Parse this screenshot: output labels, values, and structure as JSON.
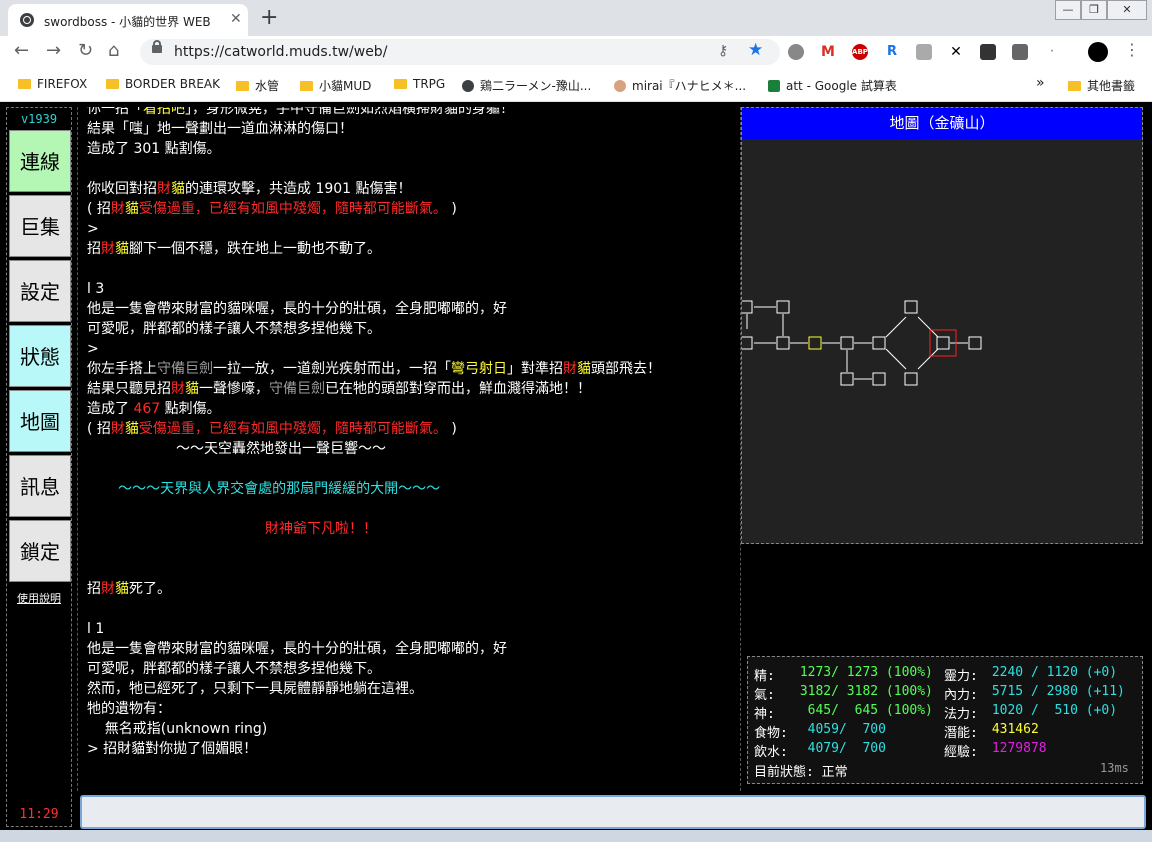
{
  "browser": {
    "tab_title": "swordboss - 小貓的世界 WEB",
    "tab_close": "✕",
    "new_tab": "+",
    "url": "https://catworld.muds.tw/web/",
    "win_min": "—",
    "win_max": "❐",
    "win_close": "✕",
    "bookmarks": [
      "FIREFOX",
      "BORDER BREAK",
      "水管",
      "小貓MUD",
      "TRPG",
      "鶏二ラーメン-豫山...",
      "mirai『ハナヒメ＊...",
      "att - Google 試算表"
    ],
    "bookmarks_overflow": "»",
    "other_bookmarks": "其他書籤"
  },
  "sidebar": {
    "version": "v1939",
    "buttons": [
      "連線",
      "巨集",
      "設定",
      "狀態",
      "地圖",
      "訊息",
      "鎖定"
    ],
    "help_link": "使用說明",
    "clock": "11:29"
  },
  "output_lines": [
    [
      [
        "w",
        "你一招「"
      ],
      [
        "y",
        "看招吧"
      ],
      [
        "w",
        "」，身形微晃，手中守備巨劍如烈焰橫掃財貓的身軀！"
      ]
    ],
    [
      [
        "w",
        "結果「嗤」地一聲劃出一道血淋淋的傷口！"
      ]
    ],
    [
      [
        "w",
        "造成了 301 點割傷。"
      ]
    ],
    [],
    [
      [
        "w",
        "你收回對招"
      ],
      [
        "r",
        "財"
      ],
      [
        "y",
        "貓"
      ],
      [
        "w",
        "的連環攻擊，共造成 1901 點傷害！"
      ]
    ],
    [
      [
        "w",
        "( 招"
      ],
      [
        "r",
        "財"
      ],
      [
        "y",
        "貓"
      ],
      [
        "r",
        "受傷過重，已經有如風中殘燭，隨時都可能斷氣。"
      ],
      [
        "w",
        " )"
      ]
    ],
    [
      [
        "w",
        ">"
      ]
    ],
    [
      [
        "w",
        "招"
      ],
      [
        "r",
        "財"
      ],
      [
        "y",
        "貓"
      ],
      [
        "w",
        "腳下一個不穩，跌在地上一動也不動了。"
      ]
    ],
    [],
    [
      [
        "w",
        "l 3"
      ]
    ],
    [
      [
        "w",
        "他是一隻會帶來財富的貓咪喔，長的十分的壯碩，全身肥嘟嘟的，好"
      ]
    ],
    [
      [
        "w",
        "可愛呢，胖都都的樣子讓人不禁想多捏他幾下。"
      ]
    ],
    [
      [
        "w",
        ">"
      ]
    ],
    [
      [
        "w",
        "你左手搭上"
      ],
      [
        "g",
        "守備巨劍"
      ],
      [
        "w",
        "一拉一放，一道劍光疾射而出，一招「"
      ],
      [
        "y",
        "彎弓射日"
      ],
      [
        "w",
        "」對準招"
      ],
      [
        "r",
        "財"
      ],
      [
        "y",
        "貓"
      ],
      [
        "w",
        "頭部飛去！"
      ]
    ],
    [
      [
        "w",
        "結果只聽見招"
      ],
      [
        "r",
        "財"
      ],
      [
        "y",
        "貓"
      ],
      [
        "w",
        "一聲慘嚎，"
      ],
      [
        "g",
        "守備巨劍"
      ],
      [
        "w",
        "已在牠的頭部對穿而出，鮮血濺得滿地！！"
      ]
    ],
    [
      [
        "w",
        "造成了 "
      ],
      [
        "r",
        "467"
      ],
      [
        "w",
        " 點刺傷。"
      ]
    ],
    [
      [
        "w",
        "( 招"
      ],
      [
        "r",
        "財"
      ],
      [
        "y",
        "貓"
      ],
      [
        "r",
        "受傷過重，已經有如風中殘燭，隨時都可能斷氣。"
      ],
      [
        "w",
        " )"
      ]
    ],
    [
      [
        "w",
        "                    ～～天空轟然地發出一聲巨響～～"
      ]
    ],
    [],
    [
      [
        "c",
        "       ～～～天界與人界交會處的那扇門緩緩的大開～～～"
      ]
    ],
    [],
    [
      [
        "r",
        "                                        財神爺下凡啦！！"
      ]
    ],
    [],
    [],
    [
      [
        "w",
        "招"
      ],
      [
        "r",
        "財"
      ],
      [
        "y",
        "貓"
      ],
      [
        "w",
        "死了。"
      ]
    ],
    [],
    [
      [
        "w",
        "l 1"
      ]
    ],
    [
      [
        "w",
        "他是一隻會帶來財富的貓咪喔，長的十分的壯碩，全身肥嘟嘟的，好"
      ]
    ],
    [
      [
        "w",
        "可愛呢，胖都都的樣子讓人不禁想多捏他幾下。"
      ]
    ],
    [
      [
        "w",
        "然而，牠已經死了，只剩下一具屍體靜靜地躺在這裡。"
      ]
    ],
    [
      [
        "w",
        "牠的遺物有："
      ]
    ],
    [
      [
        "w",
        "    無名戒指(unknown ring)"
      ]
    ],
    [
      [
        "w",
        "> 招財貓對你拋了個媚眼！"
      ]
    ]
  ],
  "map": {
    "title": "地圖（金礦山）"
  },
  "status": {
    "rows": [
      [
        [
          "st-label",
          "精:"
        ],
        [
          "st-gr",
          " 1273/ 1273 (100%)"
        ],
        [
          "st-label",
          "靈力:"
        ],
        [
          "st-c",
          " 2240 / 1120 (+0)"
        ]
      ],
      [
        [
          "st-label",
          "氣:"
        ],
        [
          "st-gr",
          " 3182/ 3182 (100%)"
        ],
        [
          "st-label",
          "內力:"
        ],
        [
          "st-c",
          " 5715 / 2980 (+11)"
        ]
      ],
      [
        [
          "st-label",
          "神:"
        ],
        [
          "st-gr",
          "  645/  645 (100%)"
        ],
        [
          "st-label",
          "法力:"
        ],
        [
          "st-c",
          " 1020 /  510 (+0)"
        ]
      ],
      [
        [
          "st-label",
          "食物:"
        ],
        [
          "st-c",
          "  4059/  700"
        ],
        [
          "st-label",
          "潛能:"
        ],
        [
          "st-y",
          " 431462"
        ]
      ],
      [
        [
          "st-label",
          "飲水:"
        ],
        [
          "st-c",
          "  4079/  700"
        ],
        [
          "st-label",
          "經驗:"
        ],
        [
          "st-m",
          " 1279878"
        ]
      ]
    ],
    "state_label": "目前狀態: 正常",
    "latency": "13ms"
  },
  "input": {
    "value": ""
  }
}
